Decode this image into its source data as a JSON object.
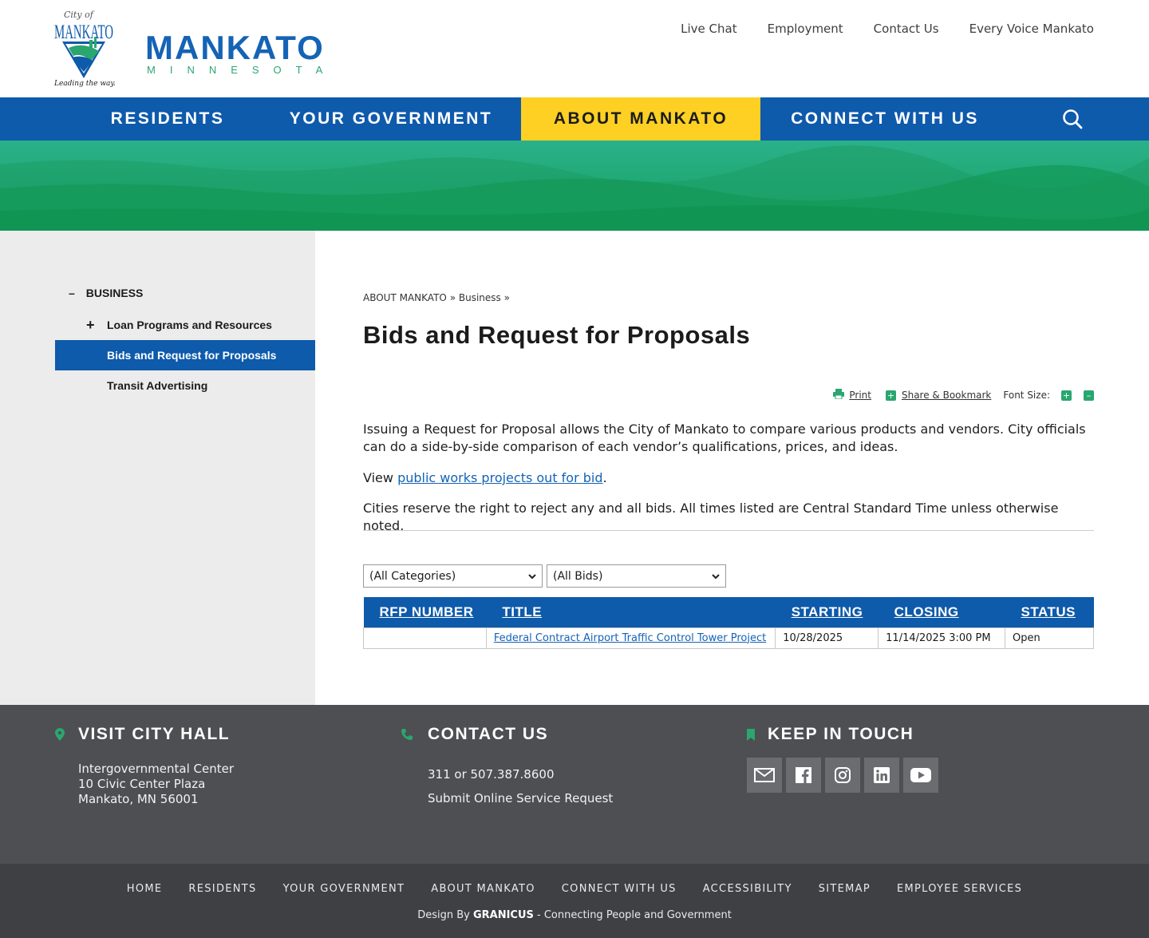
{
  "header": {
    "logo": {
      "script": "City of",
      "name": "MANKATO",
      "tagline": "Leading the way..."
    },
    "wordmark": {
      "main": "MANKATO",
      "sub": "MINNESOTA"
    },
    "utility_links": [
      "Live Chat",
      "Employment",
      "Contact Us",
      "Every Voice Mankato"
    ]
  },
  "main_nav": {
    "items": [
      "RESIDENTS",
      "YOUR GOVERNMENT",
      "ABOUT MANKATO",
      "CONNECT WITH US"
    ],
    "active": "ABOUT MANKATO",
    "search_icon": "search-icon"
  },
  "colors": {
    "brand_blue": "#0e5aab",
    "accent_yellow": "#fdd023",
    "accent_green": "#2aa66f",
    "footer_gray": "#4d4f53"
  },
  "sidebar": {
    "section": "BUSINESS",
    "items": [
      {
        "label": "Loan Programs and Resources",
        "expandable": true
      },
      {
        "label": "Bids and Request for Proposals",
        "active": true
      },
      {
        "label": "Transit Advertising"
      }
    ]
  },
  "breadcrumb": {
    "parts": [
      "ABOUT MANKATO",
      "Business"
    ],
    "separator": "»"
  },
  "page_title": "Bids and Request for Proposals",
  "tools": {
    "print": "Print",
    "share": "Share & Bookmark",
    "font_size": "Font Size:"
  },
  "body": {
    "p1": "Issuing a Request for Proposal allows the City of Mankato to compare various products and vendors. City officials can do a side-by-side comparison of each vendor’s qualifications, prices, and ideas.",
    "p2_prefix": "View ",
    "p2_link": "public works projects out for bid",
    "p2_suffix": ".",
    "p3": "Cities reserve the right to reject any and all bids. All times listed are Central Standard Time unless otherwise noted."
  },
  "filters": {
    "category": "(All Categories)",
    "bids": "(All Bids)"
  },
  "table": {
    "headers": [
      "RFP NUMBER",
      "TITLE",
      "STARTING",
      "CLOSING",
      "STATUS"
    ],
    "rows": [
      {
        "rfp": "",
        "title": "Federal Contract Airport Traffic Control Tower Project",
        "starting": "10/28/2025",
        "closing": "11/14/2025 3:00 PM",
        "status": "Open"
      }
    ]
  },
  "footer": {
    "visit": {
      "title": "VISIT CITY HALL",
      "lines": [
        "Intergovernmental Center",
        "10 Civic Center Plaza",
        "Mankato, MN 56001"
      ]
    },
    "contact": {
      "title": "CONTACT US",
      "phone": "311 or 507.387.8600",
      "service": "Submit Online Service Request"
    },
    "keep": {
      "title": "KEEP IN TOUCH",
      "icons": [
        "email-icon",
        "facebook-icon",
        "instagram-icon",
        "linkedin-icon",
        "youtube-icon"
      ]
    }
  },
  "bottom": {
    "links": [
      "HOME",
      "RESIDENTS",
      "YOUR GOVERNMENT",
      "ABOUT MANKATO",
      "CONNECT WITH US",
      "ACCESSIBILITY",
      "SITEMAP",
      "EMPLOYEE SERVICES"
    ],
    "credit_prefix": "Design By ",
    "credit_brand": "GRANICUS",
    "credit_suffix": " - Connecting People and Government"
  }
}
